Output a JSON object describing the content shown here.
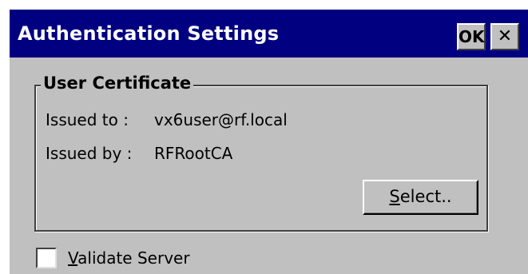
{
  "window": {
    "title": "Authentication Settings",
    "ok_label": "OK",
    "close_label": "✕"
  },
  "group": {
    "legend": "User Certificate",
    "issued_to_label": "Issued to :",
    "issued_to_value": "vx6user@rf.local",
    "issued_by_label": "Issued by :",
    "issued_by_value": "RFRootCA",
    "select_button": {
      "mnemonic": "S",
      "rest": "elect.."
    }
  },
  "validate_server": {
    "mnemonic": "V",
    "rest": "alidate Server",
    "checked": false
  },
  "colors": {
    "titlebar": "#000080",
    "face": "#c0c0c0",
    "title_text": "#ffffff"
  }
}
